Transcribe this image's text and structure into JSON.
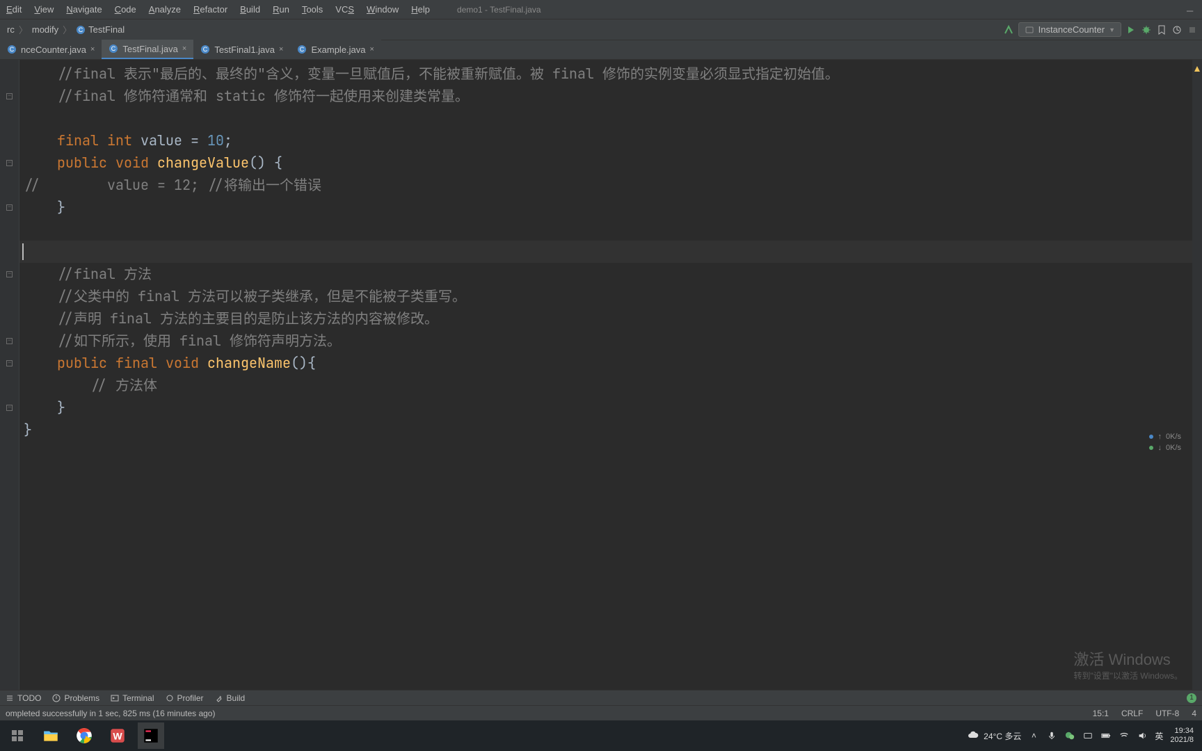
{
  "menu": [
    "Edit",
    "View",
    "Navigate",
    "Code",
    "Analyze",
    "Refactor",
    "Build",
    "Run",
    "Tools",
    "VCS",
    "Window",
    "Help"
  ],
  "menu_underline": [
    0,
    0,
    0,
    0,
    0,
    0,
    0,
    0,
    0,
    2,
    0,
    0
  ],
  "window_title": "demo1 - TestFinal.java",
  "breadcrumb": {
    "items": [
      "rc",
      "modify",
      "TestFinal"
    ]
  },
  "run_config": "InstanceCounter",
  "tabs": [
    {
      "name": "nceCounter.java",
      "active": false
    },
    {
      "name": "TestFinal.java",
      "active": true
    },
    {
      "name": "TestFinal1.java",
      "active": false
    },
    {
      "name": "Example.java",
      "active": false
    }
  ],
  "code": {
    "l1_a": "//",
    "l1_b": "final",
    "l1_c": " 表示\"最后的、最终的\"含义，变量一旦赋值后，不能被重新赋值。被 ",
    "l1_d": "final",
    "l1_e": " 修饰的实例变量必须显式指定初始值。",
    "l2_a": "//",
    "l2_b": "final",
    "l2_c": " 修饰符通常和 ",
    "l2_d": "static",
    "l2_e": " 修饰符一起使用来创建类常量。",
    "l4_a": "final int ",
    "l4_b": "value = ",
    "l4_c": "10",
    "l4_d": ";",
    "l5_a": "public void ",
    "l5_b": "changeValue",
    "l5_c": "() {",
    "l6_a": "//",
    "l6_b": "        value = 12; //将输出一个错误",
    "l7": "}",
    "l10": "//final 方法",
    "l11_a": "//父类中的 ",
    "l11_b": "final",
    "l11_c": " 方法可以被子类继承，但是不能被子类重写。",
    "l12_a": "//声明 ",
    "l12_b": "final",
    "l12_c": " 方法的主要目的是防止该方法的内容被修改。",
    "l13_a": "//如下所示，使用 ",
    "l13_b": "final",
    "l13_c": " 修饰符声明方法。",
    "l14_a": "public final void ",
    "l14_b": "changeName",
    "l14_c": "(){",
    "l15": "// 方法体",
    "l16": "}",
    "l17": "}"
  },
  "net": {
    "up": "0K/s",
    "down": "0K/s"
  },
  "watermark": {
    "big": "激活 Windows",
    "small": "转到\"设置\"以激活 Windows。"
  },
  "toolwin": {
    "todo": "TODO",
    "problems": "Problems",
    "terminal": "Terminal",
    "profiler": "Profiler",
    "build": "Build",
    "badge": "1"
  },
  "status": {
    "msg": "ompleted successfully in 1 sec, 825 ms (16 minutes ago)",
    "pos": "15:1",
    "eol": "CRLF",
    "enc": "UTF-8",
    "lang": "4"
  },
  "weather": "24°C 多云",
  "time": "19:34",
  "date": "2021/8",
  "ime": "英"
}
